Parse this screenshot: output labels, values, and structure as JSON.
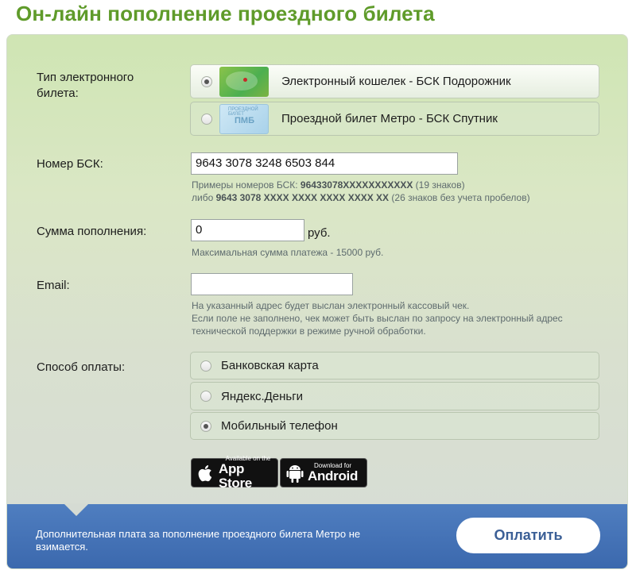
{
  "page": {
    "title": "Он-лайн пополнение проездного билета"
  },
  "ticket_type": {
    "label": "Тип электронного билета:",
    "options": [
      {
        "label": "Электронный кошелек - БСК Подорожник",
        "selected": true,
        "card_icon": "podorozhnik-card-icon"
      },
      {
        "label": "Проездной билет Метро - БСК Спутник",
        "selected": false,
        "card_icon": "sputnik-card-icon"
      }
    ],
    "sputnik_card_text": "ПМБ",
    "sputnik_card_small": "ПРОЕЗДНОЙ БИЛЕТ"
  },
  "card_number": {
    "label": "Номер БСК:",
    "value": "9643 3078 3248 6503 844",
    "hint_prefix": "Примеры номеров БСК: ",
    "hint_example1": "96433078XXXXXXXXXXX",
    "hint_example1_suffix": " (19 знаков)",
    "hint_or": "либо ",
    "hint_example2": "9643 3078 XXXX XXXX XXXX XXXX XX",
    "hint_example2_suffix": " (26 знаков без учета пробелов)"
  },
  "amount": {
    "label": "Сумма пополнения:",
    "value": "0",
    "unit": "руб.",
    "hint": "Максимальная сумма платежа - 15000 руб."
  },
  "email": {
    "label": "Email:",
    "value": "",
    "hint_line1": "На указанный адрес будет выслан электронный кассовый чек.",
    "hint_line2": "Если поле не заполнено, чек может быть выслан по запросу на электронный адрес",
    "hint_line3": "технической поддержки в режиме ручной обработки."
  },
  "payment_method": {
    "label": "Способ оплаты:",
    "options": [
      {
        "label": "Банковская карта",
        "selected": false
      },
      {
        "label": "Яндекс.Деньги",
        "selected": false
      },
      {
        "label": "Мобильный телефон",
        "selected": true
      }
    ]
  },
  "badges": {
    "appstore_small": "Available on the",
    "appstore_big": "App Store",
    "android_small": "Download for",
    "android_big": "Android"
  },
  "footer": {
    "note": "Дополнительная плата за пополнение проездного билета Метро не взимается.",
    "pay_label": "Оплатить"
  },
  "colors": {
    "title_green": "#5f9b2a",
    "footer_blue": "#3b68ad",
    "pay_text": "#3b5f96"
  }
}
